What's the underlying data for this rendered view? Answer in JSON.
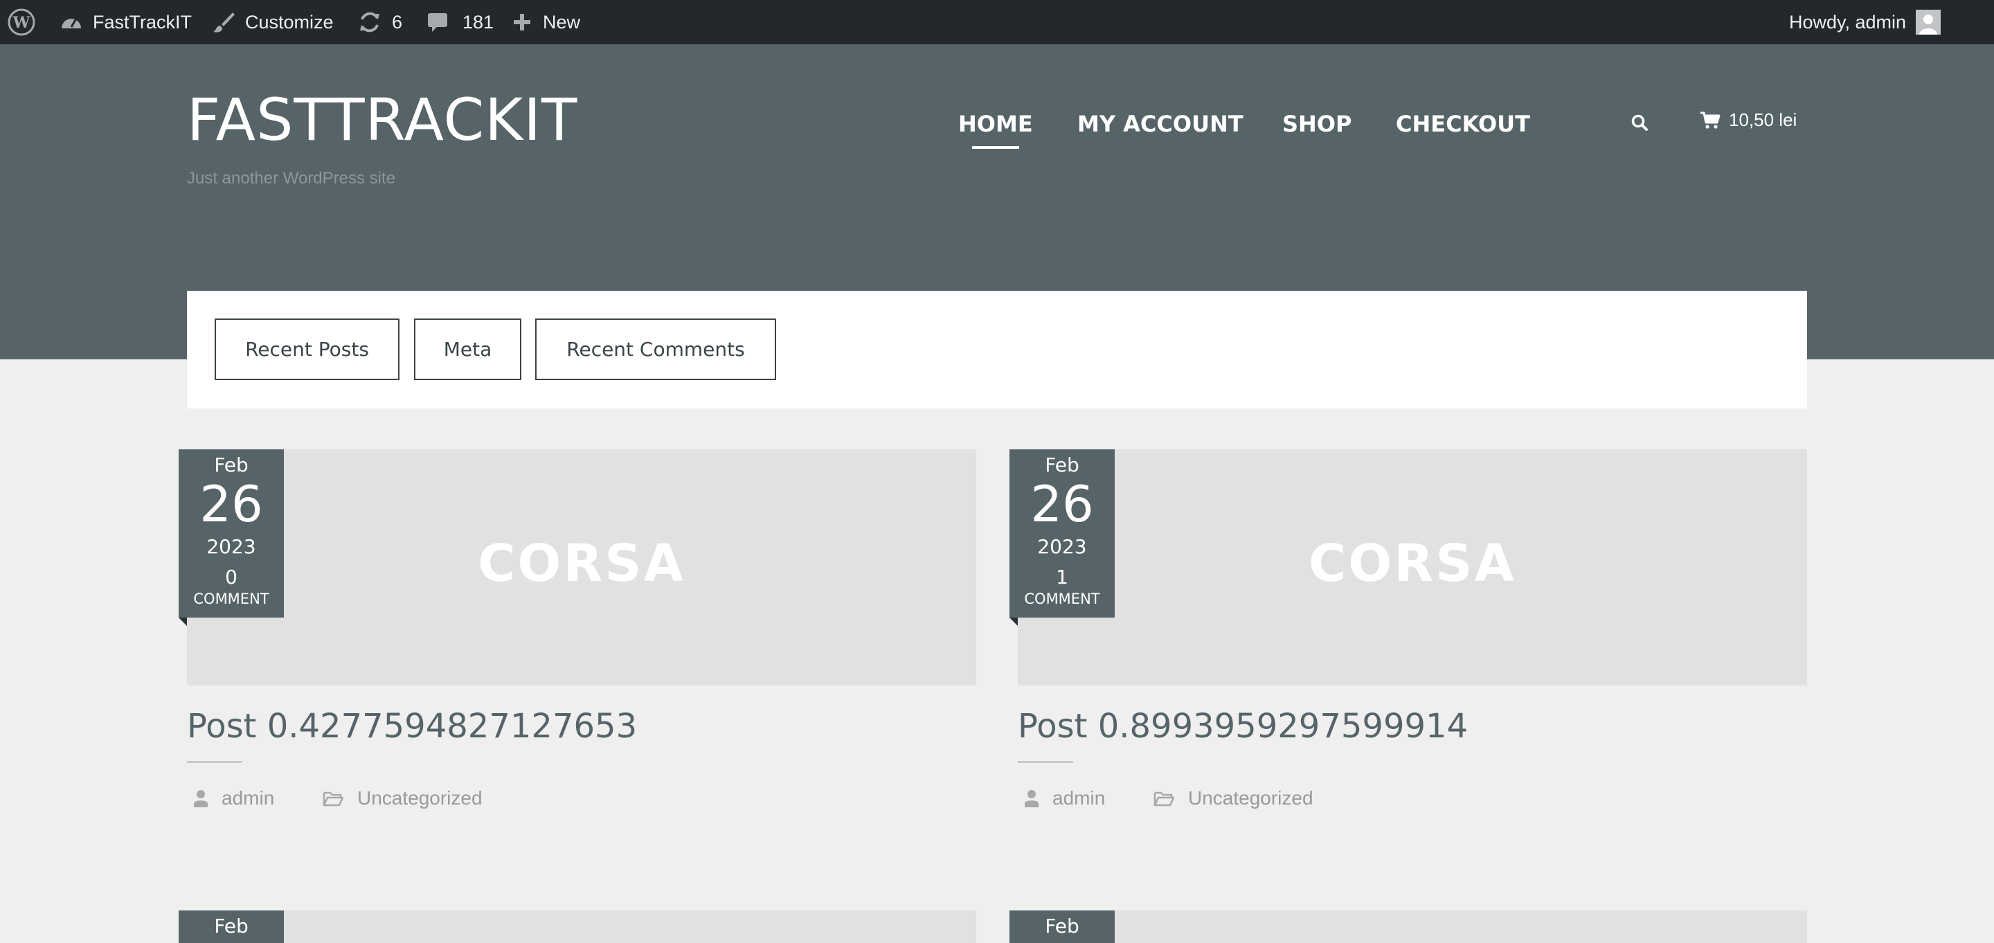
{
  "admin_bar": {
    "site_name": "FastTrackIT",
    "customize_label": "Customize",
    "updates_count": "6",
    "comments_count": "181",
    "new_label": "New",
    "howdy_label": "Howdy, admin"
  },
  "header": {
    "site_title": "FASTTRACKIT",
    "tagline": "Just another WordPress site",
    "nav": [
      "HOME",
      "MY ACCOUNT",
      "SHOP",
      "CHECKOUT"
    ],
    "active_nav": "HOME",
    "cart_total": "10,50 lei"
  },
  "widget_tabs": [
    "Recent Posts",
    "Meta",
    "Recent Comments"
  ],
  "posts": [
    {
      "thumb_label": "CORSA",
      "month": "Feb",
      "day": "26",
      "year": "2023",
      "comment_count": "0",
      "comment_label": "COMMENT",
      "title": "Post 0.4277594827127653",
      "author": "admin",
      "category": "Uncategorized"
    },
    {
      "thumb_label": "CORSA",
      "month": "Feb",
      "day": "26",
      "year": "2023",
      "comment_count": "1",
      "comment_label": "COMMENT",
      "title": "Post 0.8993959297599914",
      "author": "admin",
      "category": "Uncategorized"
    },
    {
      "month": "Feb"
    },
    {
      "month": "Feb"
    }
  ],
  "colors": {
    "admin_bar_bg": "#23282d",
    "header_bg": "#566468",
    "page_bg": "#efefef",
    "thumb_bg": "#e1e1e1"
  }
}
